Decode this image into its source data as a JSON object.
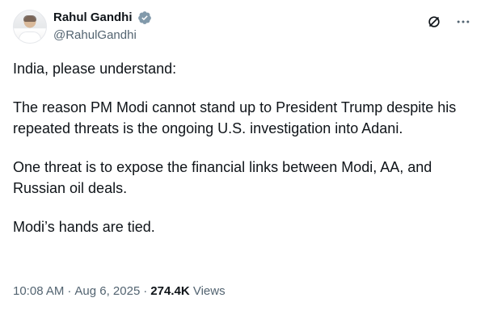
{
  "tweet": {
    "author": {
      "display_name": "Rahul Gandhi",
      "handle": "@RahulGandhi",
      "verified_icon": "verified-badge-icon"
    },
    "header_actions": {
      "grok_icon": "grok-icon",
      "more_icon": "more-icon"
    },
    "body": {
      "p1": "India, please understand:",
      "p2": "The reason PM Modi cannot stand up to President Trump despite his repeated threats is the ongoing U.S. investigation into Adani.",
      "p3": "One threat is to expose the financial links between Modi, AA, and Russian oil deals.",
      "p4": "Modi’s hands are tied."
    },
    "meta": {
      "time": "10:08 AM",
      "separator": "·",
      "date": "Aug 6, 2025",
      "views_count": "274.4K",
      "views_label": "Views"
    }
  },
  "colors": {
    "text_primary": "#0f1419",
    "text_secondary": "#536471",
    "verified_blue": "#1d9bf0"
  }
}
